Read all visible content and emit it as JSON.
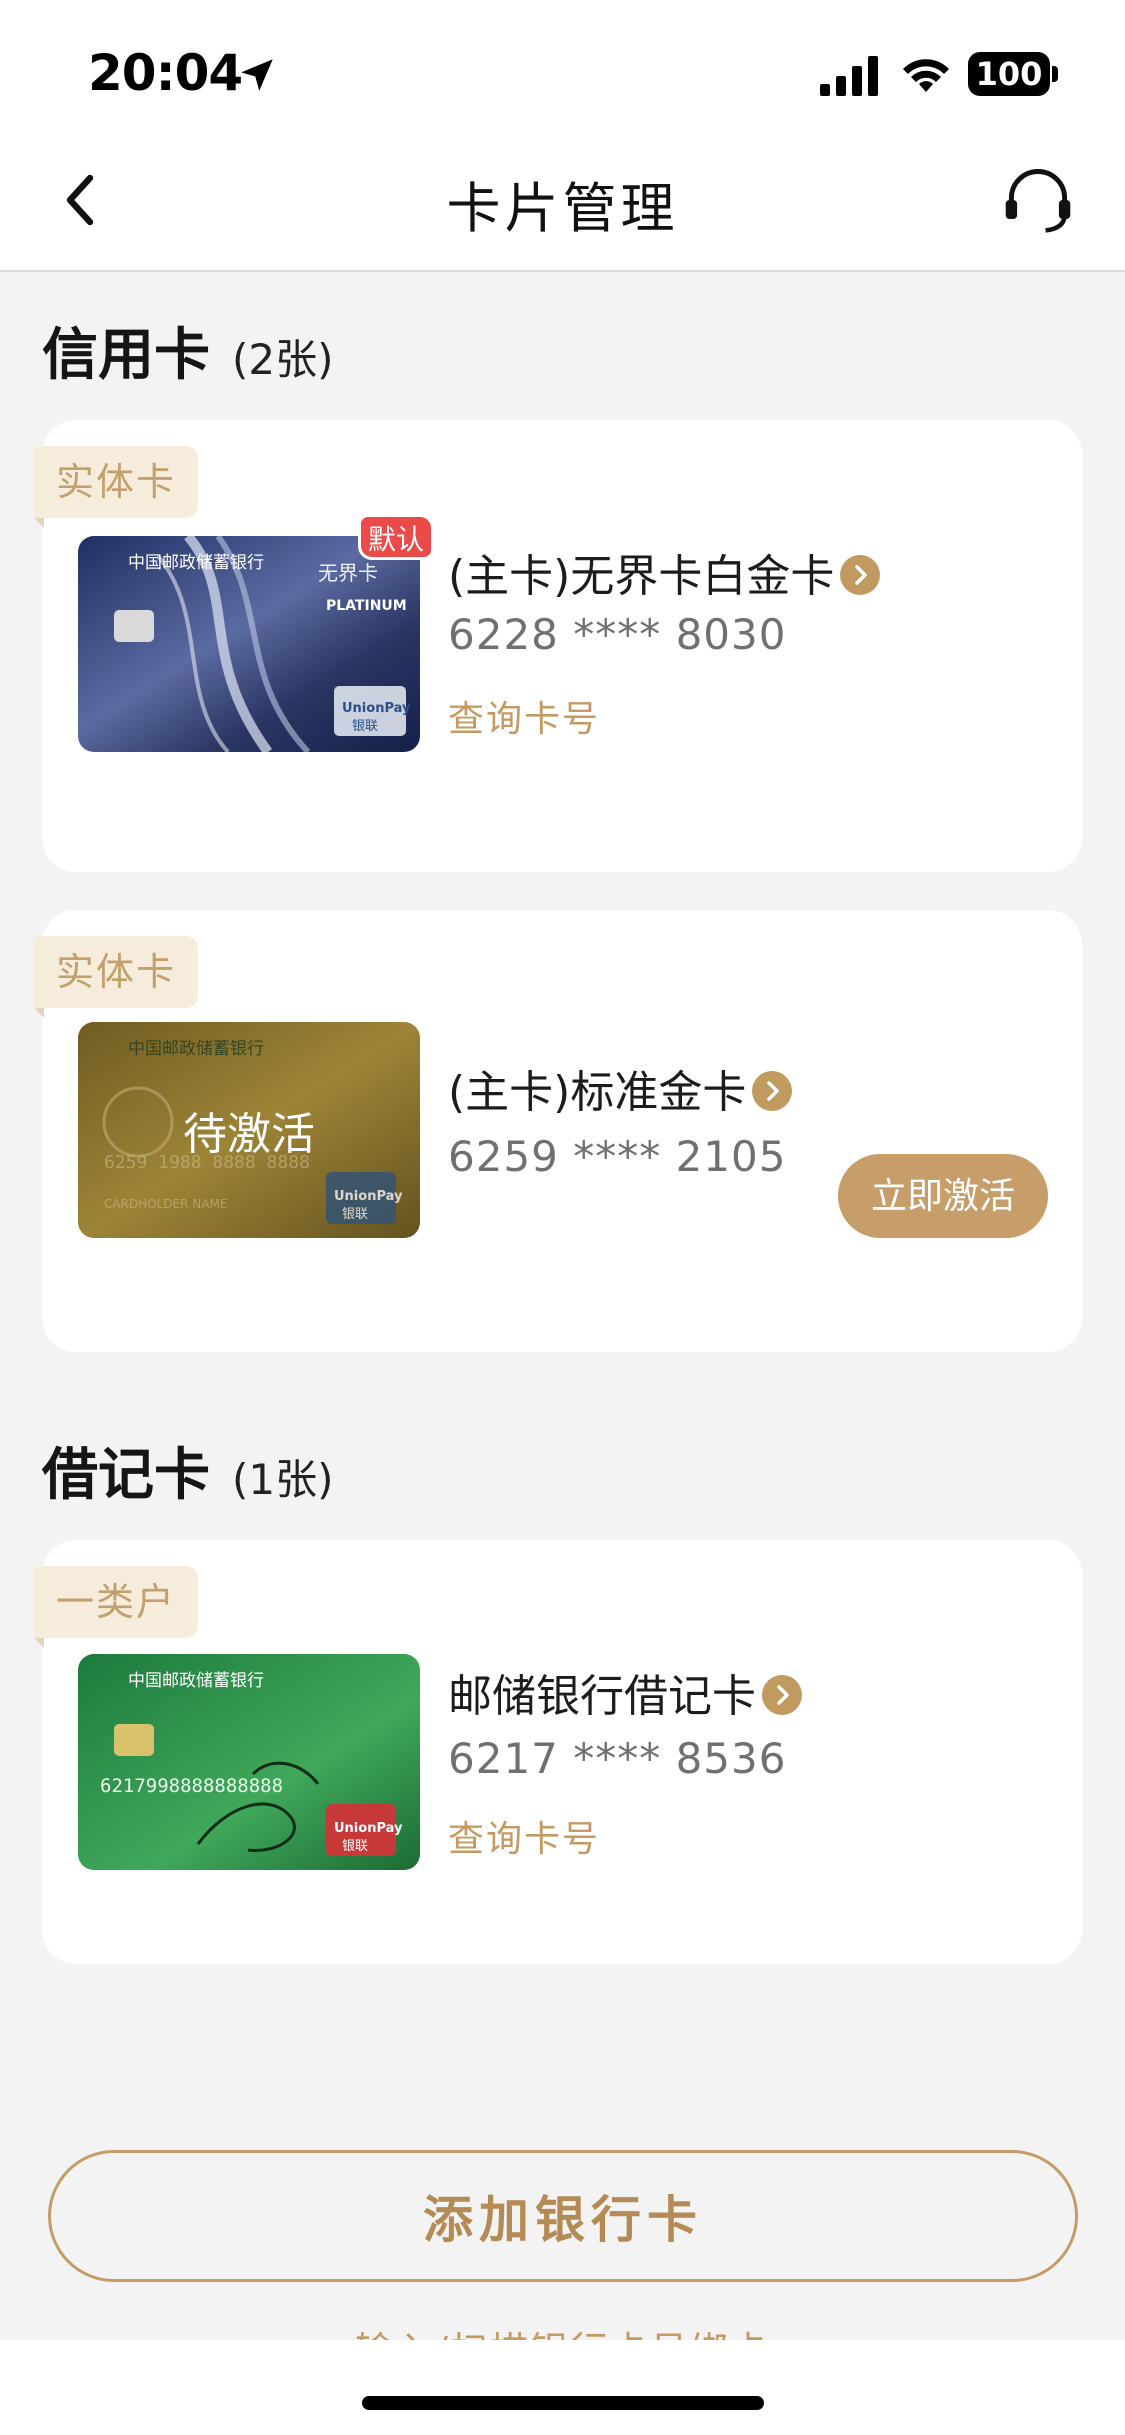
{
  "status_bar": {
    "time": "20:04",
    "battery": "100"
  },
  "nav": {
    "title": "卡片管理"
  },
  "credit_section": {
    "heading": "信用卡",
    "count": "(2张)"
  },
  "debit_section": {
    "heading": "借记卡",
    "count": "(1张)"
  },
  "cards": [
    {
      "tag": "实体卡",
      "name": "(主卡)无界卡白金卡",
      "number": "6228 **** 8030",
      "link": "查询卡号",
      "badge": "默认"
    },
    {
      "tag": "实体卡",
      "name": "(主卡)标准金卡",
      "number": "6259 **** 2105",
      "overlay": "待激活",
      "action": "立即激活"
    },
    {
      "tag": "一类户",
      "name": "邮储银行借记卡",
      "number": "6217 **** 8536",
      "link": "查询卡号"
    }
  ],
  "footer": {
    "add_button": "添加银行卡",
    "partial_link": "输入/扫描银行卡号绑卡"
  },
  "colors": {
    "accent": "#c49a62",
    "badge": "#ea4a48",
    "tag_bg": "#f6ecdc"
  }
}
